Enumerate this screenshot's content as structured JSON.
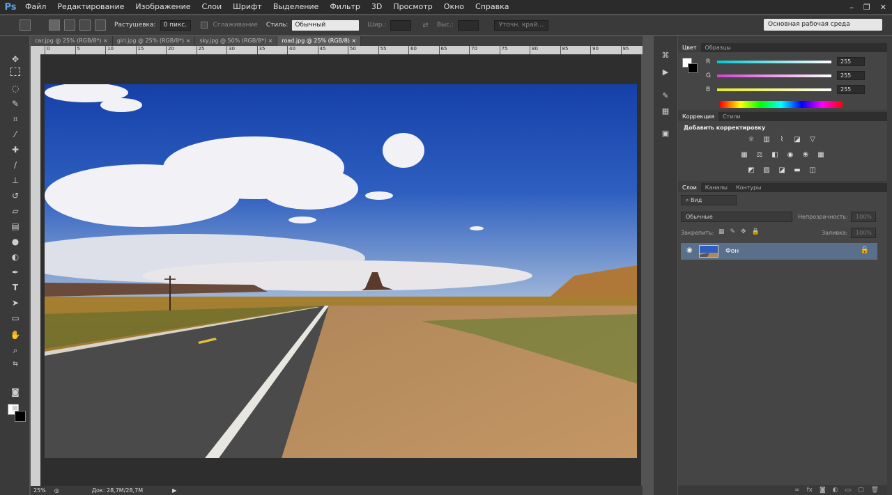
{
  "app": {
    "logo": "Ps"
  },
  "menu": [
    "Файл",
    "Редактирование",
    "Изображение",
    "Слои",
    "Шрифт",
    "Выделение",
    "Фильтр",
    "3D",
    "Просмотр",
    "Окно",
    "Справка"
  ],
  "window_controls": [
    "–",
    "❐",
    "✕"
  ],
  "options": {
    "feather_label": "Растушевка:",
    "feather_value": "0 пикс.",
    "antialias_label": "Сглаживание",
    "style_label": "Стиль:",
    "style_value": "Обычный",
    "width_label": "Шир.:",
    "height_label": "Выс.:",
    "refine_label": "Уточн. край...",
    "workspace": "Основная рабочая среда"
  },
  "tabs": [
    {
      "label": "car.jpg @ 25% (RGB/8*)",
      "close": "×"
    },
    {
      "label": "girl.jpg @ 25% (RGB/8*)",
      "close": "×"
    },
    {
      "label": "sky.jpg @ 50% (RGB/8*)",
      "close": "×"
    },
    {
      "label": "road.jpg @ 25% (RGB/8)",
      "close": "×"
    }
  ],
  "ruler_ticks": [
    "0",
    "5",
    "10",
    "15",
    "20",
    "25",
    "30",
    "35",
    "40",
    "45",
    "50",
    "55",
    "60",
    "65",
    "70",
    "75",
    "80",
    "85",
    "90",
    "95"
  ],
  "status": {
    "zoom": "25%",
    "doc": "Док: 28,7M/28,7M",
    "arrow": "▶"
  },
  "color_panel": {
    "tabs": [
      "Цвет",
      "Образцы"
    ],
    "channels": [
      {
        "label": "R",
        "value": "255",
        "color": "#00c8d4"
      },
      {
        "label": "G",
        "value": "255",
        "color": "#d640d6"
      },
      {
        "label": "B",
        "value": "255",
        "color": "#e8e820"
      }
    ]
  },
  "adjust_panel": {
    "tabs": [
      "Коррекция",
      "Стили"
    ],
    "heading": "Добавить корректировку"
  },
  "layers_panel": {
    "tabs": [
      "Слои",
      "Каналы",
      "Контуры"
    ],
    "filter": "Вид",
    "blend_mode": "Обычные",
    "opacity_label": "Непрозрачность:",
    "opacity_value": "100%",
    "lock_label": "Закрепить:",
    "fill_label": "Заливка:",
    "fill_value": "100%",
    "layer_name": "Фон"
  }
}
